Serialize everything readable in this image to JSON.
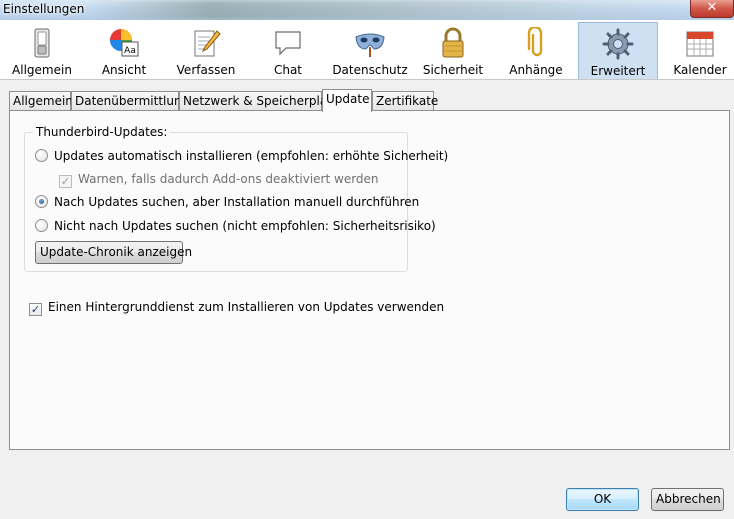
{
  "window": {
    "title": "Einstellungen",
    "close_label": "✕"
  },
  "toolbar": {
    "items": [
      {
        "label": "Allgemein",
        "icon": "switch-icon"
      },
      {
        "label": "Ansicht",
        "icon": "color-wheel-icon"
      },
      {
        "label": "Verfassen",
        "icon": "notepad-pencil-icon"
      },
      {
        "label": "Chat",
        "icon": "speech-bubble-icon"
      },
      {
        "label": "Datenschutz",
        "icon": "mask-icon"
      },
      {
        "label": "Sicherheit",
        "icon": "padlock-icon"
      },
      {
        "label": "Anhänge",
        "icon": "paperclip-icon"
      },
      {
        "label": "Erweitert",
        "icon": "gear-icon",
        "selected": true
      },
      {
        "label": "Kalender",
        "icon": "calendar-icon"
      }
    ]
  },
  "tabs": [
    {
      "label": "Allgemein"
    },
    {
      "label": "Datenübermittlung"
    },
    {
      "label": "Netzwerk & Speicherplatz"
    },
    {
      "label": "Update",
      "active": true
    },
    {
      "label": "Zertifikate"
    }
  ],
  "updates": {
    "group_title": "Thunderbird-Updates:",
    "options": [
      {
        "label": "Updates automatisch installieren (empfohlen: erhöhte Sicherheit)",
        "checked": false
      },
      {
        "label": "Nach Updates suchen, aber Installation manuell durchführen",
        "checked": true
      },
      {
        "label": "Nicht nach Updates suchen (nicht empfohlen: Sicherheitsrisiko)",
        "checked": false
      }
    ],
    "warn_checkbox_label": "Warnen, falls dadurch Add-ons deaktiviert werden",
    "history_button": "Update-Chronik anzeigen"
  },
  "background_service": {
    "label": "Einen Hintergrunddienst zum Installieren von Updates verwenden",
    "checked": true
  },
  "buttons": {
    "ok": "OK",
    "cancel": "Abbrechen"
  },
  "colors": {
    "selected_tab_bg": "#cfe0f3",
    "default_button_border": "#3c7fb1",
    "close_button": "#c03a2c"
  }
}
